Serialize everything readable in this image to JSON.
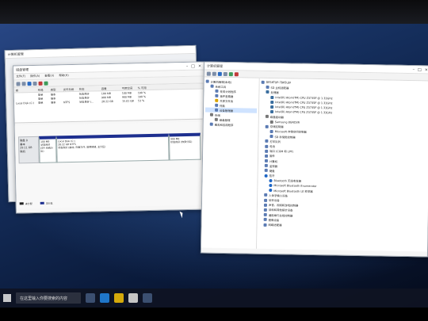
{
  "back_window": {
    "title": "计算机管理"
  },
  "disk_window": {
    "title": "磁盘管理",
    "menu": [
      "文件(F)",
      "操作(A)",
      "查看(V)",
      "帮助(H)"
    ],
    "columns": [
      "卷",
      "布局",
      "类型",
      "文件系统",
      "状态",
      "容量",
      "可用空间",
      "% 可用"
    ],
    "rows": [
      [
        "",
        "简单",
        "基本",
        "",
        "状态良好",
        "100 MB",
        "100 MB",
        "100 %"
      ],
      [
        "",
        "简单",
        "基本",
        "",
        "状态良好",
        "900 MB",
        "900 MB",
        "100 %"
      ],
      [
        "Local Disk (C:)",
        "简单",
        "基本",
        "NTFS",
        "状态良好 (...",
        "28.22 GB",
        "15.01 GB",
        "53 %"
      ]
    ],
    "disk0": {
      "name": "磁盘 0",
      "kind": "基本",
      "size": "29.11 GB",
      "state": "联机"
    },
    "partitions": [
      {
        "name": "",
        "size": "100 MB",
        "state": "状态良好 (EFI 系统分区)"
      },
      {
        "name": "Local Disk (C:)",
        "size": "28.22 GB NTFS",
        "state": "状态良好 (启动, 页面文件, 故障转储, 主分区)"
      },
      {
        "name": "",
        "size": "900 MB",
        "state": "状态良好 (恢复分区)"
      }
    ],
    "legend": [
      "未分配",
      "主分区"
    ]
  },
  "mgmt_window": {
    "title": "计算机管理",
    "tree": [
      {
        "label": "计算机管理(本地)",
        "level": 0
      },
      {
        "label": "系统工具",
        "level": 1
      },
      {
        "label": "任务计划程序",
        "level": 2
      },
      {
        "label": "事件查看器",
        "level": 2
      },
      {
        "label": "共享文件夹",
        "level": 2
      },
      {
        "label": "性能",
        "level": 2
      },
      {
        "label": "设备管理器",
        "level": 2,
        "selected": true
      },
      {
        "label": "存储",
        "level": 1
      },
      {
        "label": "磁盘管理",
        "level": 2
      },
      {
        "label": "服务和应用程序",
        "level": 1
      }
    ],
    "devices": [
      {
        "label": "DESKTOP-7BK5UJV",
        "level": 0,
        "icon": "computer-icon"
      },
      {
        "label": "SD 主机适配器",
        "level": 1,
        "icon": "device-icon"
      },
      {
        "label": "处理器",
        "level": 1,
        "icon": "cpu-icon"
      },
      {
        "label": "Intel(R) Atom(TM) CPU  Z3735F @ 1.33GHz",
        "level": 2,
        "icon": "cpu-icon"
      },
      {
        "label": "Intel(R) Atom(TM) CPU  Z3735F @ 1.33GHz",
        "level": 2,
        "icon": "cpu-icon"
      },
      {
        "label": "Intel(R) Atom(TM) CPU  Z3735F @ 1.33GHz",
        "level": 2,
        "icon": "cpu-icon"
      },
      {
        "label": "Intel(R) Atom(TM) CPU  Z3735F @ 1.33GHz",
        "level": 2,
        "icon": "cpu-icon"
      },
      {
        "label": "磁盘驱动器",
        "level": 1,
        "icon": "disk-icon"
      },
      {
        "label": "Samsung 8GND3R",
        "level": 2,
        "icon": "disk-icon"
      },
      {
        "label": "存储控制器",
        "level": 1,
        "icon": "device-icon"
      },
      {
        "label": "Microsoft 存储空间控制器",
        "level": 2,
        "icon": "device-icon"
      },
      {
        "label": "SD 存储类控制器",
        "level": 2,
        "icon": "device-icon"
      },
      {
        "label": "打印队列",
        "level": 1,
        "icon": "device-icon"
      },
      {
        "label": "电池",
        "level": 1,
        "icon": "device-icon"
      },
      {
        "label": "端口 (COM 和 LPT)",
        "level": 1,
        "icon": "device-icon"
      },
      {
        "label": "固件",
        "level": 1,
        "icon": "device-icon"
      },
      {
        "label": "计算机",
        "level": 1,
        "icon": "device-icon"
      },
      {
        "label": "监视器",
        "level": 1,
        "icon": "device-icon"
      },
      {
        "label": "键盘",
        "level": 1,
        "icon": "device-icon"
      },
      {
        "label": "蓝牙",
        "level": 1,
        "icon": "bluetooth-icon"
      },
      {
        "label": "Bluetooth 无线收发器",
        "level": 2,
        "icon": "bluetooth-icon"
      },
      {
        "label": "Microsoft Bluetooth Enumerator",
        "level": 2,
        "icon": "bluetooth-icon"
      },
      {
        "label": "Microsoft Bluetooth LE 枚举器",
        "level": 2,
        "icon": "bluetooth-icon"
      },
      {
        "label": "人体学输入设备",
        "level": 1,
        "icon": "device-icon"
      },
      {
        "label": "软件设备",
        "level": 1,
        "icon": "device-icon"
      },
      {
        "label": "声音、视频和游戏控制器",
        "level": 1,
        "icon": "device-icon"
      },
      {
        "label": "鼠标和其他指针设备",
        "level": 1,
        "icon": "device-icon"
      },
      {
        "label": "通用串行总线控制器",
        "level": 1,
        "icon": "device-icon"
      },
      {
        "label": "图像设备",
        "level": 1,
        "icon": "device-icon"
      },
      {
        "label": "网络适配器",
        "level": 1,
        "icon": "device-icon"
      }
    ]
  },
  "taskbar": {
    "search_placeholder": "在这里输入你要搜索的内容"
  }
}
